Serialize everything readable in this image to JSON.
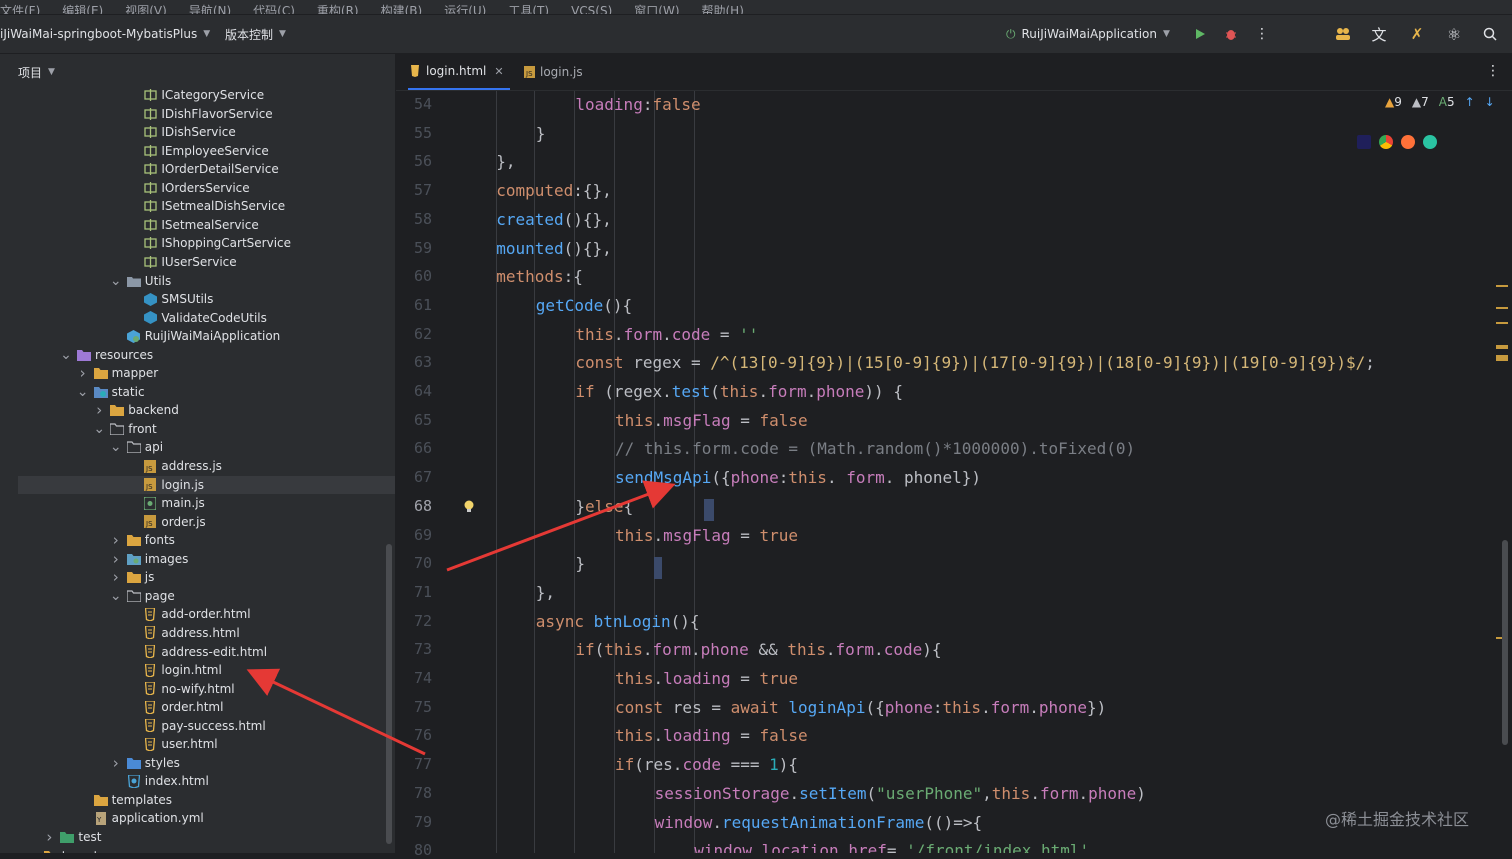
{
  "toolbar": {
    "project_name": "iJiWaiMai-springboot-MybatisPlus",
    "vcs_label": "版本控制",
    "run_config": "RuiJiWaiMaiApplication"
  },
  "project_panel": {
    "title": "项目",
    "items": [
      {
        "label": "ICategoryService",
        "icon": "interface-icon",
        "depth": 9,
        "arrow": ""
      },
      {
        "label": "IDishFlavorService",
        "icon": "interface-icon",
        "depth": 9,
        "arrow": ""
      },
      {
        "label": "IDishService",
        "icon": "interface-icon",
        "depth": 9,
        "arrow": ""
      },
      {
        "label": "IEmployeeService",
        "icon": "interface-icon",
        "depth": 9,
        "arrow": ""
      },
      {
        "label": "IOrderDetailService",
        "icon": "interface-icon",
        "depth": 9,
        "arrow": ""
      },
      {
        "label": "IOrdersService",
        "icon": "interface-icon",
        "depth": 9,
        "arrow": ""
      },
      {
        "label": "ISetmealDishService",
        "icon": "interface-icon",
        "depth": 9,
        "arrow": ""
      },
      {
        "label": "ISetmealService",
        "icon": "interface-icon",
        "depth": 9,
        "arrow": ""
      },
      {
        "label": "IShoppingCartService",
        "icon": "interface-icon",
        "depth": 9,
        "arrow": ""
      },
      {
        "label": "IUserService",
        "icon": "interface-icon",
        "depth": 9,
        "arrow": ""
      },
      {
        "label": "Utils",
        "icon": "package-icon",
        "depth": 8,
        "arrow": "down"
      },
      {
        "label": "SMSUtils",
        "icon": "class-icon",
        "depth": 9,
        "arrow": ""
      },
      {
        "label": "ValidateCodeUtils",
        "icon": "class-icon",
        "depth": 9,
        "arrow": ""
      },
      {
        "label": "RuiJiWaiMaiApplication",
        "icon": "spring-class-icon",
        "depth": 8,
        "arrow": ""
      },
      {
        "label": "resources",
        "icon": "resources-folder-icon",
        "depth": 5,
        "arrow": "down"
      },
      {
        "label": "mapper",
        "icon": "folder-icon",
        "depth": 6,
        "arrow": "right"
      },
      {
        "label": "static",
        "icon": "web-folder-icon",
        "depth": 6,
        "arrow": "down"
      },
      {
        "label": "backend",
        "icon": "folder-icon",
        "depth": 7,
        "arrow": "right"
      },
      {
        "label": "front",
        "icon": "folder-open-icon",
        "depth": 7,
        "arrow": "down"
      },
      {
        "label": "api",
        "icon": "folder-open-icon",
        "depth": 8,
        "arrow": "down"
      },
      {
        "label": "address.js",
        "icon": "js-file-icon",
        "depth": 9,
        "arrow": ""
      },
      {
        "label": "login.js",
        "icon": "js-file-icon",
        "depth": 9,
        "arrow": "",
        "selected": true
      },
      {
        "label": "main.js",
        "icon": "js-main-icon",
        "depth": 9,
        "arrow": ""
      },
      {
        "label": "order.js",
        "icon": "js-file-icon",
        "depth": 9,
        "arrow": ""
      },
      {
        "label": "fonts",
        "icon": "folder-icon",
        "depth": 8,
        "arrow": "right"
      },
      {
        "label": "images",
        "icon": "images-folder-icon",
        "depth": 8,
        "arrow": "right"
      },
      {
        "label": "js",
        "icon": "folder-icon",
        "depth": 8,
        "arrow": "right"
      },
      {
        "label": "page",
        "icon": "folder-open-icon",
        "depth": 8,
        "arrow": "down"
      },
      {
        "label": "add-order.html",
        "icon": "html-file-icon",
        "depth": 9,
        "arrow": ""
      },
      {
        "label": "address.html",
        "icon": "html-file-icon",
        "depth": 9,
        "arrow": ""
      },
      {
        "label": "address-edit.html",
        "icon": "html-file-icon",
        "depth": 9,
        "arrow": ""
      },
      {
        "label": "login.html",
        "icon": "html-file-icon",
        "depth": 9,
        "arrow": ""
      },
      {
        "label": "no-wify.html",
        "icon": "html-file-icon",
        "depth": 9,
        "arrow": ""
      },
      {
        "label": "order.html",
        "icon": "html-file-icon",
        "depth": 9,
        "arrow": ""
      },
      {
        "label": "pay-success.html",
        "icon": "html-file-icon",
        "depth": 9,
        "arrow": ""
      },
      {
        "label": "user.html",
        "icon": "html-file-icon",
        "depth": 9,
        "arrow": ""
      },
      {
        "label": "styles",
        "icon": "styles-folder-icon",
        "depth": 8,
        "arrow": "right"
      },
      {
        "label": "index.html",
        "icon": "html-index-icon",
        "depth": 8,
        "arrow": ""
      },
      {
        "label": "templates",
        "icon": "folder-icon",
        "depth": 6,
        "arrow": ""
      },
      {
        "label": "application.yml",
        "icon": "yaml-file-icon",
        "depth": 6,
        "arrow": ""
      },
      {
        "label": "test",
        "icon": "test-folder-icon",
        "depth": 4,
        "arrow": "right"
      },
      {
        "label": "target",
        "icon": "folder-icon",
        "depth": 3,
        "arrow": "right"
      }
    ]
  },
  "editor": {
    "tabs": [
      {
        "label": "login.html",
        "icon": "html-file-icon",
        "active": true,
        "closable": true
      },
      {
        "label": "login.js",
        "icon": "js-file-icon",
        "active": false,
        "closable": false
      }
    ],
    "inspection": {
      "warnings": "9",
      "weak_warnings": "7",
      "typos": "5"
    },
    "current_line": 68,
    "lines": [
      {
        "n": "54",
        "indent": 4,
        "tokens": [
          [
            "p",
            "loading"
          ],
          [
            "d",
            ":"
          ],
          [
            "k",
            "false"
          ]
        ]
      },
      {
        "n": "55",
        "indent": 3,
        "tokens": [
          [
            "d",
            "}"
          ]
        ]
      },
      {
        "n": "56",
        "indent": 2,
        "tokens": [
          [
            "d",
            "},"
          ]
        ]
      },
      {
        "n": "57",
        "indent": 2,
        "tokens": [
          [
            "k",
            "computed"
          ],
          [
            "d",
            ":{},"
          ]
        ]
      },
      {
        "n": "58",
        "indent": 2,
        "tokens": [
          [
            "f",
            "created"
          ],
          [
            "d",
            "(){},"
          ]
        ]
      },
      {
        "n": "59",
        "indent": 2,
        "tokens": [
          [
            "f",
            "mounted"
          ],
          [
            "d",
            "(){},"
          ]
        ]
      },
      {
        "n": "60",
        "indent": 2,
        "tokens": [
          [
            "k",
            "methods"
          ],
          [
            "d",
            ":{"
          ]
        ]
      },
      {
        "n": "61",
        "indent": 3,
        "tokens": [
          [
            "f",
            "getCode"
          ],
          [
            "d",
            "(){"
          ]
        ]
      },
      {
        "n": "62",
        "indent": 4,
        "tokens": [
          [
            "k",
            "this"
          ],
          [
            "d",
            "."
          ],
          [
            "p",
            "form"
          ],
          [
            "d",
            "."
          ],
          [
            "p",
            "code"
          ],
          [
            "d",
            " = "
          ],
          [
            "s",
            "''"
          ]
        ]
      },
      {
        "n": "63",
        "indent": 4,
        "tokens": [
          [
            "k",
            "const "
          ],
          [
            "d",
            "regex = "
          ],
          [
            "r",
            "/^(13[0-9]{9})|(15[0-9]{9})|(17[0-9]{9})|(18[0-9]{9})|(19[0-9]{9})$/"
          ],
          [
            "d",
            ";"
          ]
        ]
      },
      {
        "n": "64",
        "indent": 4,
        "tokens": [
          [
            "k",
            "if "
          ],
          [
            "d",
            "(regex."
          ],
          [
            "f",
            "test"
          ],
          [
            "d",
            "("
          ],
          [
            "k",
            "this"
          ],
          [
            "d",
            "."
          ],
          [
            "p",
            "form"
          ],
          [
            "d",
            "."
          ],
          [
            "p",
            "phone"
          ],
          [
            "d",
            ")) {"
          ]
        ]
      },
      {
        "n": "65",
        "indent": 5,
        "tokens": [
          [
            "k",
            "this"
          ],
          [
            "d",
            "."
          ],
          [
            "p",
            "msgFlag"
          ],
          [
            "d",
            " = "
          ],
          [
            "k",
            "false"
          ]
        ]
      },
      {
        "n": "66",
        "indent": 5,
        "tokens": [
          [
            "c",
            "// this.form.code = (Math.random()*1000000).toFixed(0)"
          ]
        ]
      },
      {
        "n": "67",
        "indent": 5,
        "tokens": [
          [
            "f",
            "sendMsgApi"
          ],
          [
            "d",
            "({"
          ],
          [
            "p",
            "phone"
          ],
          [
            "d",
            ":"
          ],
          [
            "k",
            "this"
          ],
          [
            "d",
            ". "
          ],
          [
            "p",
            "form"
          ],
          [
            "d",
            ". "
          ],
          [
            "d",
            "phonel"
          ],
          [
            "d",
            "})"
          ]
        ]
      },
      {
        "n": "68",
        "indent": 4,
        "tokens": [
          [
            "d",
            "}"
          ],
          [
            "k",
            "else"
          ],
          [
            "d",
            "{"
          ]
        ]
      },
      {
        "n": "69",
        "indent": 5,
        "tokens": [
          [
            "k",
            "this"
          ],
          [
            "d",
            "."
          ],
          [
            "p",
            "msgFlag"
          ],
          [
            "d",
            " = "
          ],
          [
            "k",
            "true"
          ]
        ]
      },
      {
        "n": "70",
        "indent": 4,
        "tokens": [
          [
            "d",
            "}"
          ]
        ]
      },
      {
        "n": "71",
        "indent": 3,
        "tokens": [
          [
            "d",
            "},"
          ]
        ]
      },
      {
        "n": "72",
        "indent": 3,
        "tokens": [
          [
            "k",
            "async "
          ],
          [
            "f",
            "btnLogin"
          ],
          [
            "d",
            "(){"
          ]
        ]
      },
      {
        "n": "73",
        "indent": 4,
        "tokens": [
          [
            "k",
            "if"
          ],
          [
            "d",
            "("
          ],
          [
            "k",
            "this"
          ],
          [
            "d",
            "."
          ],
          [
            "p",
            "form"
          ],
          [
            "d",
            "."
          ],
          [
            "p",
            "phone"
          ],
          [
            "d",
            " && "
          ],
          [
            "k",
            "this"
          ],
          [
            "d",
            "."
          ],
          [
            "p",
            "form"
          ],
          [
            "d",
            "."
          ],
          [
            "p",
            "code"
          ],
          [
            "d",
            "){"
          ]
        ]
      },
      {
        "n": "74",
        "indent": 5,
        "tokens": [
          [
            "k",
            "this"
          ],
          [
            "d",
            "."
          ],
          [
            "p",
            "loading"
          ],
          [
            "d",
            " = "
          ],
          [
            "k",
            "true"
          ]
        ]
      },
      {
        "n": "75",
        "indent": 5,
        "tokens": [
          [
            "k",
            "const "
          ],
          [
            "d",
            "res = "
          ],
          [
            "k",
            "await "
          ],
          [
            "f",
            "loginApi"
          ],
          [
            "d",
            "({"
          ],
          [
            "p",
            "phone"
          ],
          [
            "d",
            ":"
          ],
          [
            "k",
            "this"
          ],
          [
            "d",
            "."
          ],
          [
            "p",
            "form"
          ],
          [
            "d",
            "."
          ],
          [
            "p",
            "phone"
          ],
          [
            "d",
            "})"
          ]
        ]
      },
      {
        "n": "76",
        "indent": 5,
        "tokens": [
          [
            "k",
            "this"
          ],
          [
            "d",
            "."
          ],
          [
            "p",
            "loading"
          ],
          [
            "d",
            " = "
          ],
          [
            "k",
            "false"
          ]
        ]
      },
      {
        "n": "77",
        "indent": 5,
        "tokens": [
          [
            "k",
            "if"
          ],
          [
            "d",
            "(res."
          ],
          [
            "p",
            "code"
          ],
          [
            "d",
            " === "
          ],
          [
            "n",
            "1"
          ],
          [
            "d",
            "){"
          ]
        ]
      },
      {
        "n": "78",
        "indent": 6,
        "tokens": [
          [
            "p",
            "sessionStorage"
          ],
          [
            "d",
            "."
          ],
          [
            "f",
            "setItem"
          ],
          [
            "d",
            "("
          ],
          [
            "s",
            "\"userPhone\""
          ],
          [
            "d",
            ","
          ],
          [
            "k",
            "this"
          ],
          [
            "d",
            "."
          ],
          [
            "p",
            "form"
          ],
          [
            "d",
            "."
          ],
          [
            "p",
            "phone"
          ],
          [
            "d",
            ")"
          ]
        ]
      },
      {
        "n": "79",
        "indent": 6,
        "tokens": [
          [
            "p",
            "window"
          ],
          [
            "d",
            "."
          ],
          [
            "f",
            "requestAnimationFrame"
          ],
          [
            "d",
            "(()=>{"
          ]
        ]
      },
      {
        "n": "80",
        "indent": 7,
        "tokens": [
          [
            "p",
            "window"
          ],
          [
            "d",
            "."
          ],
          [
            "p",
            "location"
          ],
          [
            "d",
            "."
          ],
          [
            "p",
            "href"
          ],
          [
            "d",
            "= "
          ],
          [
            "s",
            "'/front/index.html'"
          ]
        ]
      }
    ]
  },
  "watermark": "@稀土掘金技术社区",
  "colors": {
    "arrow": "#e53935",
    "accent": "#3574f0"
  }
}
